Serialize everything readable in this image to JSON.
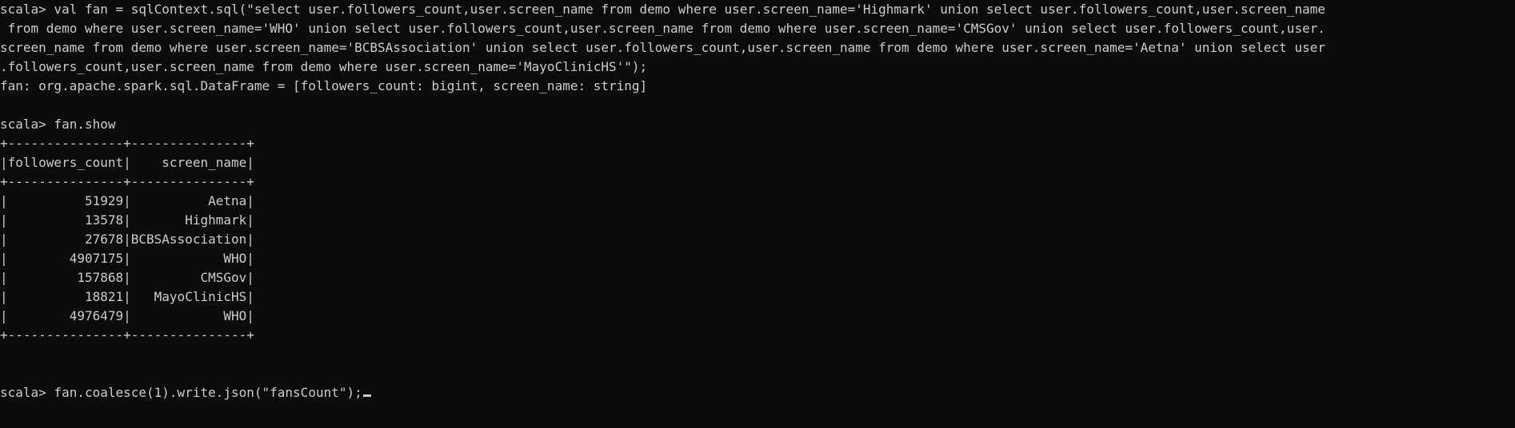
{
  "terminal": {
    "lines": [
      "scala> val fan = sqlContext.sql(\"select user.followers_count,user.screen_name from demo where user.screen_name='Highmark' union select user.followers_count,user.screen_name",
      " from demo where user.screen_name='WHO' union select user.followers_count,user.screen_name from demo where user.screen_name='CMSGov' union select user.followers_count,user.",
      "screen_name from demo where user.screen_name='BCBSAssociation' union select user.followers_count,user.screen_name from demo where user.screen_name='Aetna' union select user",
      ".followers_count,user.screen_name from demo where user.screen_name='MayoClinicHS'\");",
      "fan: org.apache.spark.sql.DataFrame = [followers_count: bigint, screen_name: string]",
      "",
      "scala> fan.show",
      "+---------------+---------------+",
      "|followers_count|    screen_name|",
      "+---------------+---------------+",
      "|          51929|          Aetna|",
      "|          13578|       Highmark|",
      "|          27678|BCBSAssociation|",
      "|        4907175|            WHO|",
      "|         157868|         CMSGov|",
      "|          18821|   MayoClinicHS|",
      "|        4976479|            WHO|",
      "+---------------+---------------+",
      "",
      "",
      "scala> fan.coalesce(1).write.json(\"fansCount\");"
    ]
  }
}
